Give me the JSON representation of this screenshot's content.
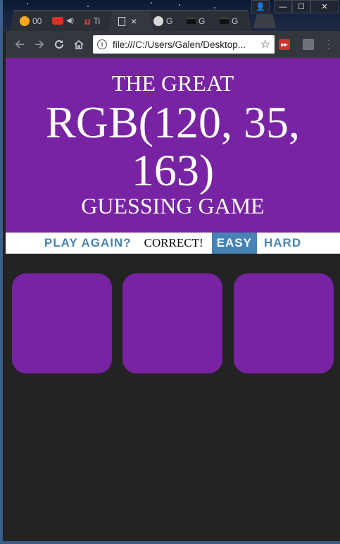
{
  "browser": {
    "tabs": [
      {
        "label": "00",
        "favicon_color": "#f4a81d",
        "active": false
      },
      {
        "label": "",
        "favicon_color": "#e52d27",
        "active": false,
        "audio": true
      },
      {
        "label": "Ti",
        "favicon_color": "#e24a3b",
        "active": false
      },
      {
        "label": "×",
        "favicon_color": "#d8d8d8",
        "active": true
      },
      {
        "label": "G",
        "favicon_color": "#d8d8d8",
        "active": false
      },
      {
        "label": "G",
        "favicon_color": "#222222",
        "active": false
      },
      {
        "label": "G",
        "favicon_color": "#222222",
        "active": false
      }
    ],
    "window_buttons": {
      "minimize": "—",
      "maximize": "☐",
      "close": "✕"
    },
    "address": "file:///C:/Users/Galen/Desktop...",
    "icons": {
      "back": "arrow-left-icon",
      "forward": "arrow-right-icon",
      "reload": "reload-icon",
      "home": "home-icon",
      "info": "info-icon",
      "bookmark": "star-icon",
      "menu": "kebab-menu-icon"
    }
  },
  "game": {
    "heading_top": "THE GREAT",
    "rgb_display": "RGB(120, 35, 163)",
    "heading_bottom": "GUESSING GAME",
    "header_color": "#7823a3",
    "reset_label": "PLAY AGAIN?",
    "message": "CORRECT!",
    "modes": [
      {
        "label": "EASY",
        "selected": true
      },
      {
        "label": "HARD",
        "selected": false
      }
    ],
    "squares": [
      "#7823a3",
      "#7823a3",
      "#7823a3"
    ],
    "accent": "#4682b4",
    "background": "#232323"
  }
}
